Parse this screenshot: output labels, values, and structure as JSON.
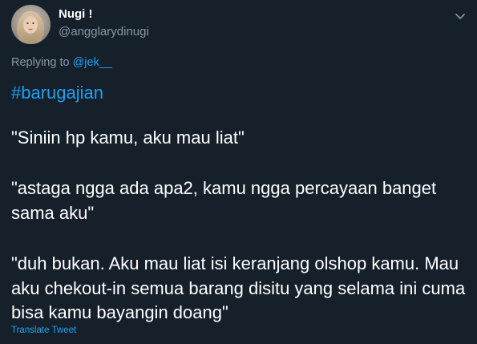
{
  "colors": {
    "background": "#15202b",
    "primary_text": "#ffffff",
    "secondary_text": "#8899a6",
    "accent": "#1da1f2"
  },
  "tweet": {
    "author": {
      "display_name": "Nugi !",
      "handle": "@angglarydinugi",
      "avatar_icon": "profile-photo"
    },
    "menu_icon": "chevron-down-icon",
    "reply_context": {
      "prefix": "Replying to",
      "mention": "@jek__"
    },
    "hashtag": "#barugajian",
    "paragraphs": [
      "\"Siniin hp kamu, aku mau liat\"",
      "\"astaga ngga ada apa2, kamu ngga percayaan banget sama aku\"",
      "\"duh bukan. Aku mau liat isi keranjang olshop kamu. Mau aku chekout-in semua barang disitu yang selama ini cuma bisa kamu bayangin doang\""
    ],
    "translate_label": "Translate Tweet"
  }
}
